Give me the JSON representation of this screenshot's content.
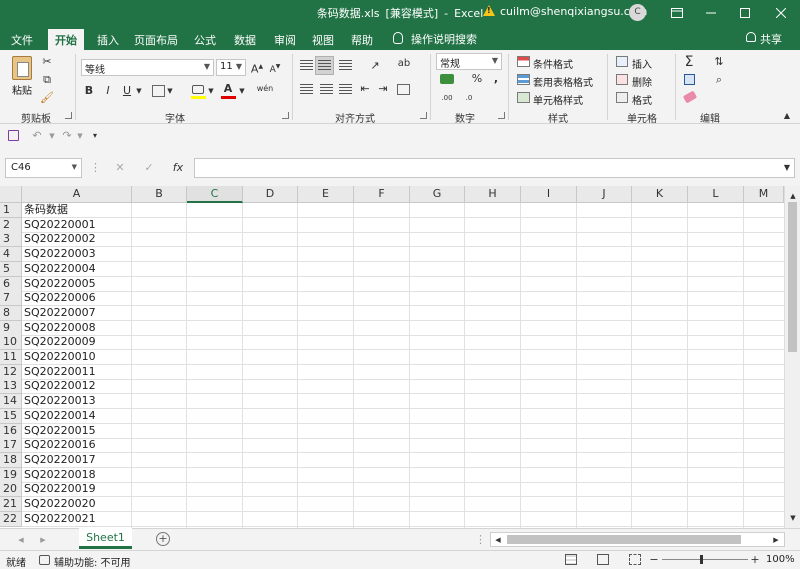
{
  "window": {
    "title_file": "条码数据.xls",
    "title_mode": "[兼容模式]",
    "title_sep": "-",
    "title_app": "Excel",
    "user_email": "cuilm@shenqixiangsu.com",
    "avatar_letter": "C"
  },
  "tabs": [
    "文件",
    "开始",
    "插入",
    "页面布局",
    "公式",
    "数据",
    "审阅",
    "视图",
    "帮助"
  ],
  "tell_me": "操作说明搜索",
  "share": "共享",
  "ribbon": {
    "clipboard": {
      "paste": "粘贴",
      "label": "剪贴板"
    },
    "font": {
      "name": "等线",
      "size": "11",
      "label": "字体",
      "bold": "B",
      "italic": "I",
      "underline": "U",
      "grow": "A",
      "shrink": "A",
      "font_color_glyph": "A",
      "phonetic": "wén"
    },
    "alignment": {
      "label": "对齐方式",
      "wrap_glyph": "ab"
    },
    "number": {
      "format": "常规",
      "label": "数字",
      "percent": "%",
      "comma": ","
    },
    "styles": {
      "conditional": "条件格式",
      "table": "套用表格格式",
      "cell": "单元格样式",
      "label": "样式"
    },
    "cells": {
      "insert": "插入",
      "delete": "删除",
      "format": "格式",
      "label": "单元格"
    },
    "editing": {
      "label": "编辑",
      "sigma": "Σ"
    }
  },
  "formula_bar": {
    "name_box": "C46",
    "fx": "fx",
    "cancel": "✕",
    "enter": "✓",
    "value": ""
  },
  "grid": {
    "columns": [
      "A",
      "B",
      "C",
      "D",
      "E",
      "F",
      "G",
      "H",
      "I",
      "J",
      "K",
      "L",
      "M"
    ],
    "selected_column": "C",
    "rows": [
      {
        "n": "1",
        "a": "条码数据"
      },
      {
        "n": "2",
        "a": "SQ20220001"
      },
      {
        "n": "3",
        "a": "SQ20220002"
      },
      {
        "n": "4",
        "a": "SQ20220003"
      },
      {
        "n": "5",
        "a": "SQ20220004"
      },
      {
        "n": "6",
        "a": "SQ20220005"
      },
      {
        "n": "7",
        "a": "SQ20220006"
      },
      {
        "n": "8",
        "a": "SQ20220007"
      },
      {
        "n": "9",
        "a": "SQ20220008"
      },
      {
        "n": "10",
        "a": "SQ20220009"
      },
      {
        "n": "11",
        "a": "SQ20220010"
      },
      {
        "n": "12",
        "a": "SQ20220011"
      },
      {
        "n": "13",
        "a": "SQ20220012"
      },
      {
        "n": "14",
        "a": "SQ20220013"
      },
      {
        "n": "15",
        "a": "SQ20220014"
      },
      {
        "n": "16",
        "a": "SQ20220015"
      },
      {
        "n": "17",
        "a": "SQ20220016"
      },
      {
        "n": "18",
        "a": "SQ20220017"
      },
      {
        "n": "19",
        "a": "SQ20220018"
      },
      {
        "n": "20",
        "a": "SQ20220019"
      },
      {
        "n": "21",
        "a": "SQ20220020"
      },
      {
        "n": "22",
        "a": "SQ20220021"
      }
    ]
  },
  "sheets": {
    "active": "Sheet1",
    "add": "+"
  },
  "status": {
    "ready": "就绪",
    "accessibility": "辅助功能: 不可用",
    "zoom": "100%"
  },
  "colors": {
    "accent": "#217346",
    "ribbon_bg": "#f3f3f3"
  }
}
